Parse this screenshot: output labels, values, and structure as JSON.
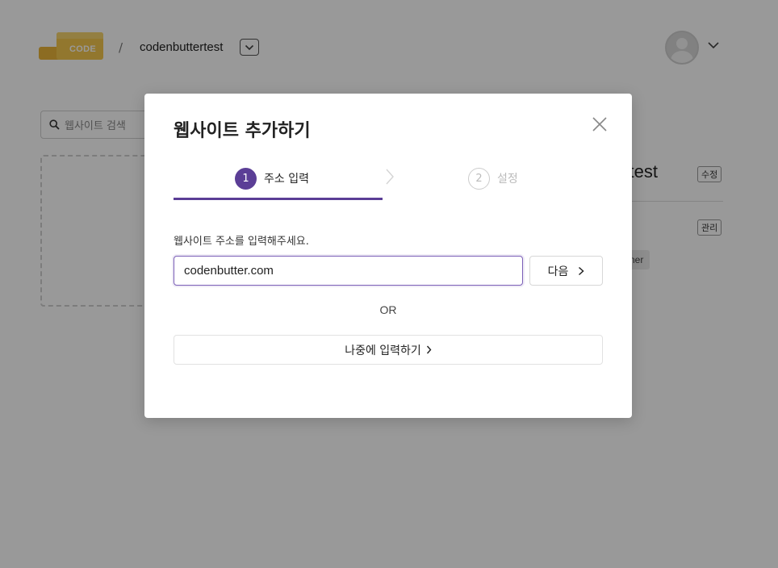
{
  "header": {
    "logo_text": "CODE",
    "breadcrumb_separator": "/",
    "org_name": "codenbuttertest"
  },
  "background": {
    "search_placeholder": "웹사이트 검색",
    "site_title_fragment": "ertest",
    "edit_badge": "수정",
    "manage_badge": "관리",
    "role_chip": "ner"
  },
  "modal": {
    "title": "웹사이트 추가하기",
    "steps": [
      {
        "number": "1",
        "label": "주소 입력",
        "active": true
      },
      {
        "number": "2",
        "label": "설정",
        "active": false
      }
    ],
    "field_label": "웹사이트 주소를 입력해주세요.",
    "url_value": "codenbutter.com",
    "next_label": "다음",
    "or_label": "OR",
    "later_label": "나중에 입력하기"
  },
  "icons": {
    "close": "close-icon",
    "search": "search-icon",
    "chevron": "chevron-right-icon",
    "caret": "chevron-down-icon"
  },
  "colors": {
    "accent": "#5b3e96",
    "input_focus": "#7b5fb7",
    "logo_yellow": "#f3c64d"
  }
}
